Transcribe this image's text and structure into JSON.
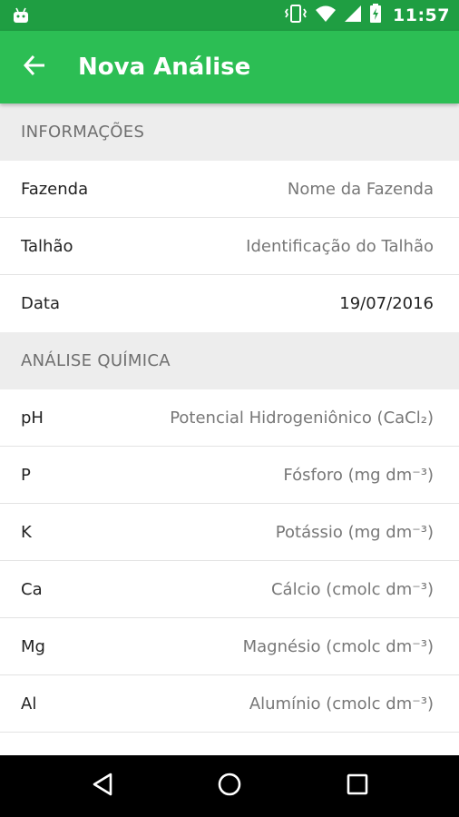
{
  "status_bar": {
    "time": "11:57",
    "icons": [
      "android-icon",
      "vibrate-icon",
      "wifi-icon",
      "signal-icon",
      "battery-charging-icon"
    ]
  },
  "app_bar": {
    "title": "Nova Análise",
    "back_icon": "arrow-back-icon"
  },
  "sections": {
    "info": {
      "header": "INFORMAÇÕES",
      "rows": [
        {
          "label": "Fazenda",
          "value": "Nome da Fazenda"
        },
        {
          "label": "Talhão",
          "value": "Identificação do Talhão"
        },
        {
          "label": "Data",
          "value": "19/07/2016"
        }
      ]
    },
    "chem": {
      "header": "ANÁLISE QUÍMICA",
      "rows": [
        {
          "label": "pH",
          "value": "Potencial Hidrogeniônico (CaCl₂)"
        },
        {
          "label": "P",
          "value": "Fósforo (mg dm⁻³)"
        },
        {
          "label": "K",
          "value": "Potássio (mg dm⁻³)"
        },
        {
          "label": "Ca",
          "value": "Cálcio (cmolc dm⁻³)"
        },
        {
          "label": "Mg",
          "value": "Magnésio (cmolc dm⁻³)"
        },
        {
          "label": "Al",
          "value": "Alumínio (cmolc dm⁻³)"
        }
      ]
    }
  },
  "nav_bar": {
    "icons": [
      "nav-back-icon",
      "nav-home-icon",
      "nav-recents-icon"
    ]
  },
  "colors": {
    "status_bar": "#1f9e42",
    "app_bar": "#2cbe54",
    "section_bg": "#ededed"
  }
}
